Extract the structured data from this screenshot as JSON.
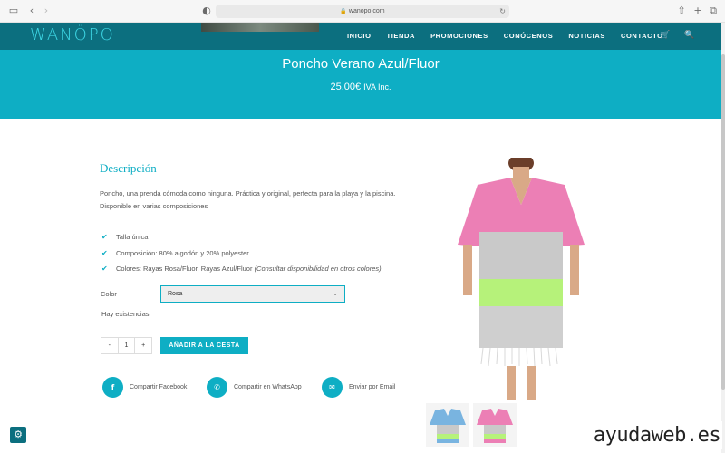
{
  "browser": {
    "url": "wanopo.com",
    "sidebar_icon": "sidebar-icon",
    "back_icon": "back-icon",
    "forward_icon": "forward-icon",
    "privacy_icon": "privacy-icon",
    "reload_icon": "reload-icon",
    "share_icon": "share-icon",
    "new_tab_icon": "plus-icon",
    "tabs_icon": "tabs-icon"
  },
  "header": {
    "logo": "WANÖPO",
    "nav": [
      "INICIO",
      "TIENDA",
      "PROMOCIONES",
      "CONÓCENOS",
      "NOTICIAS",
      "CONTACTO"
    ],
    "cart_icon": "cart-icon",
    "search_icon": "search-icon"
  },
  "product": {
    "title": "Poncho Verano Azul/Fluor",
    "price": "25.00€",
    "price_suffix": "IVA Inc.",
    "description_title": "Descripción",
    "description": "Poncho, una prenda cómoda como ninguna. Práctica y original, perfecta para la playa y la piscina. Disponible en varias composiciones",
    "features": [
      {
        "text": "Talla única",
        "note": ""
      },
      {
        "text": "Composición: 80% algodón y 20% polyester",
        "note": ""
      },
      {
        "text": "Colores: Rayas Rosa/Fluor, Rayas Azul/Fluor ",
        "note": "(Consultar disponibilidad en otros colores)"
      }
    ],
    "color_label": "Color",
    "color_selected": "Rosa",
    "stock": "Hay existencias",
    "qty_minus": "-",
    "qty_value": "1",
    "qty_plus": "+",
    "add_to_cart": "AÑADIR A LA CESTA"
  },
  "share": [
    {
      "icon": "facebook-icon",
      "glyph": "f",
      "label": "Compartir Facebook"
    },
    {
      "icon": "whatsapp-icon",
      "glyph": "✆",
      "label": "Compartir en WhatsApp"
    },
    {
      "icon": "email-icon",
      "glyph": "✉",
      "label": "Enviar por Email"
    }
  ],
  "watermark": "ayudaweb.es",
  "colors": {
    "accent": "#0eaec4",
    "nav_bg": "#0c6f7f",
    "pink": "#ec7fb5",
    "gray": "#c9c9c9",
    "fluor": "#b6f27a",
    "blue": "#79b4e0"
  }
}
